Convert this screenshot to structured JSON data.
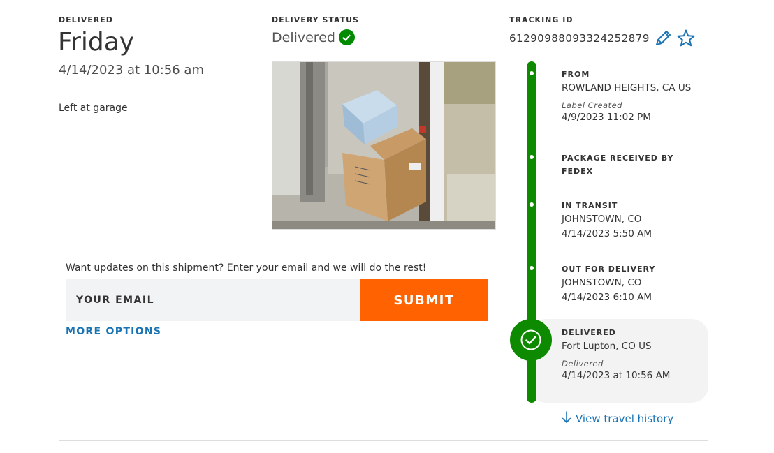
{
  "delivery": {
    "label": "DELIVERED",
    "day": "Friday",
    "datetime": "4/14/2023 at 10:56 am",
    "left_at": "Left at garage"
  },
  "status": {
    "label": "DELIVERY STATUS",
    "value": "Delivered"
  },
  "photo": {
    "icon": "package-photo"
  },
  "email_updates": {
    "prompt": "Want updates on this shipment? Enter your email and we will do the rest!",
    "placeholder": "YOUR EMAIL",
    "submit_label": "SUBMIT",
    "more_options": "MORE OPTIONS"
  },
  "tracking": {
    "label": "TRACKING ID",
    "id": "61290988093324252879"
  },
  "timeline": {
    "from": {
      "heading": "FROM",
      "location": "ROWLAND HEIGHTS, CA US",
      "event": "Label Created",
      "datetime": "4/9/2023 11:02 PM"
    },
    "received": {
      "heading_line1": "PACKAGE RECEIVED BY",
      "heading_line2": "FEDEX"
    },
    "in_transit": {
      "heading": "IN TRANSIT",
      "location": "JOHNSTOWN, CO",
      "datetime": "4/14/2023 5:50 AM"
    },
    "out_for_delivery": {
      "heading": "OUT FOR DELIVERY",
      "location": "JOHNSTOWN, CO",
      "datetime": "4/14/2023 6:10 AM"
    },
    "delivered": {
      "heading": "DELIVERED",
      "location": "Fort Lupton, CO US",
      "event": "Delivered",
      "datetime": "4/14/2023 at 10:56 AM"
    }
  },
  "view_history": "View travel history",
  "colors": {
    "green": "#0e8a00",
    "orange": "#ff6200",
    "link_blue": "#1a73b3"
  }
}
